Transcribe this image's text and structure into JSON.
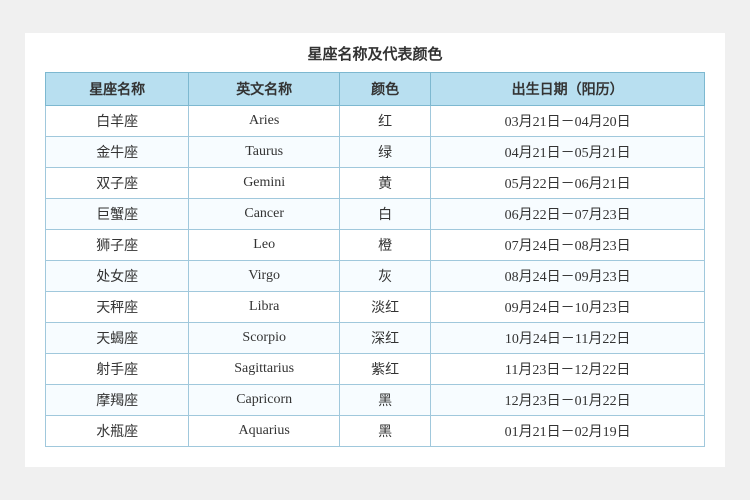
{
  "title": "星座名称及代表颜色",
  "headers": [
    "星座名称",
    "英文名称",
    "颜色",
    "出生日期（阳历）"
  ],
  "rows": [
    {
      "zh": "白羊座",
      "en": "Aries",
      "color": "红",
      "date": "03月21日－04月20日"
    },
    {
      "zh": "金牛座",
      "en": "Taurus",
      "color": "绿",
      "date": "04月21日－05月21日"
    },
    {
      "zh": "双子座",
      "en": "Gemini",
      "color": "黄",
      "date": "05月22日－06月21日"
    },
    {
      "zh": "巨蟹座",
      "en": "Cancer",
      "color": "白",
      "date": "06月22日－07月23日"
    },
    {
      "zh": "狮子座",
      "en": "Leo",
      "color": "橙",
      "date": "07月24日－08月23日"
    },
    {
      "zh": "处女座",
      "en": "Virgo",
      "color": "灰",
      "date": "08月24日－09月23日"
    },
    {
      "zh": "天秤座",
      "en": "Libra",
      "color": "淡红",
      "date": "09月24日－10月23日"
    },
    {
      "zh": "天蝎座",
      "en": "Scorpio",
      "color": "深红",
      "date": "10月24日－11月22日"
    },
    {
      "zh": "射手座",
      "en": "Sagittarius",
      "color": "紫红",
      "date": "11月23日－12月22日"
    },
    {
      "zh": "摩羯座",
      "en": "Capricorn",
      "color": "黑",
      "date": "12月23日－01月22日"
    },
    {
      "zh": "水瓶座",
      "en": "Aquarius",
      "color": "黑",
      "date": "01月21日－02月19日"
    }
  ]
}
